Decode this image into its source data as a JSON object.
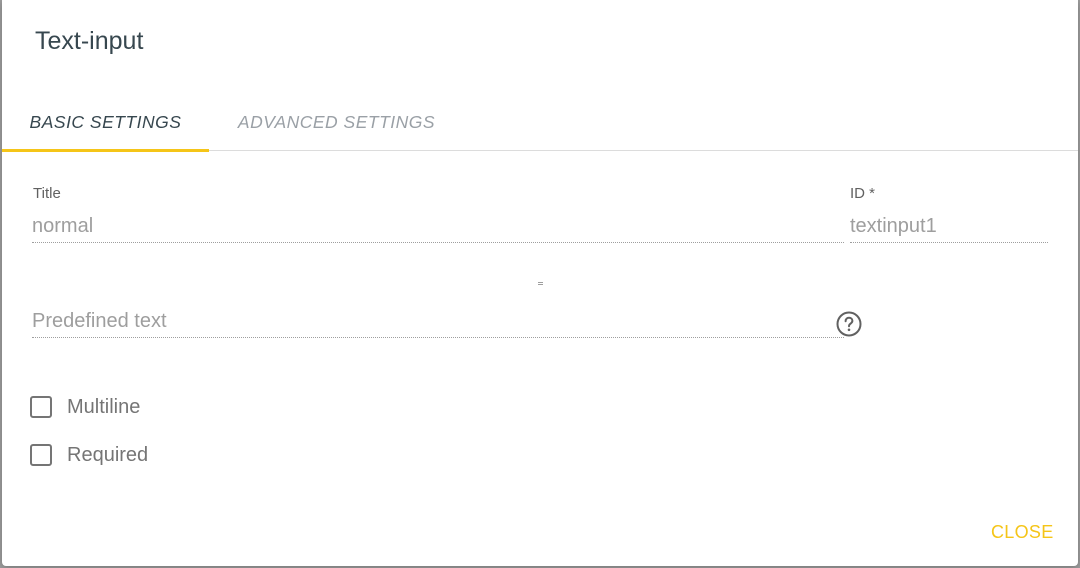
{
  "dialog": {
    "title": "Text-input"
  },
  "tabs": [
    {
      "label": "BASIC SETTINGS",
      "active": true
    },
    {
      "label": "ADVANCED SETTINGS",
      "active": false
    }
  ],
  "fields": {
    "title": {
      "label": "Title",
      "placeholder": "normal",
      "value": ""
    },
    "id": {
      "label": "ID *",
      "placeholder": "",
      "value": "textinput1"
    },
    "predefined": {
      "placeholder": "Predefined text",
      "value": ""
    }
  },
  "checkboxes": [
    {
      "label": "Multiline",
      "checked": false
    },
    {
      "label": "Required",
      "checked": false
    }
  ],
  "actions": {
    "close_label": "CLOSE"
  },
  "colors": {
    "accent": "#f5c518",
    "title_text": "#37474f",
    "muted_text": "#9aa0a6"
  },
  "icons": {
    "help": "help-circle-icon"
  }
}
